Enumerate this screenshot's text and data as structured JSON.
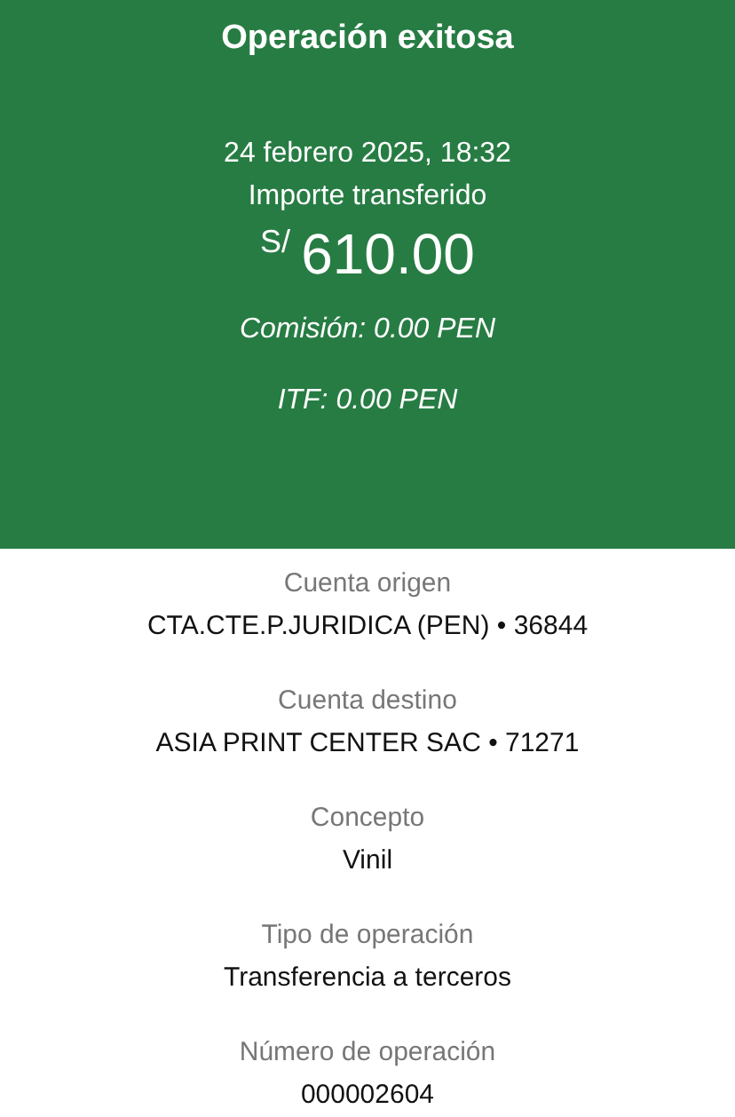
{
  "header": {
    "title": "Operación exitosa",
    "date": "24 febrero 2025, 18:32",
    "amount_label": "Importe transferido",
    "currency": "S/",
    "amount": "610.00",
    "commission": "Comisión: 0.00 PEN",
    "itf": "ITF: 0.00 PEN"
  },
  "details": [
    {
      "label": "Cuenta origen",
      "value": "CTA.CTE.P.JURIDICA (PEN) • 36844"
    },
    {
      "label": "Cuenta destino",
      "value": "ASIA PRINT CENTER SAC • 71271"
    },
    {
      "label": "Concepto",
      "value": "Vinil"
    },
    {
      "label": "Tipo de operación",
      "value": "Transferencia a terceros"
    },
    {
      "label": "Número de operación",
      "value": "000002604"
    }
  ]
}
